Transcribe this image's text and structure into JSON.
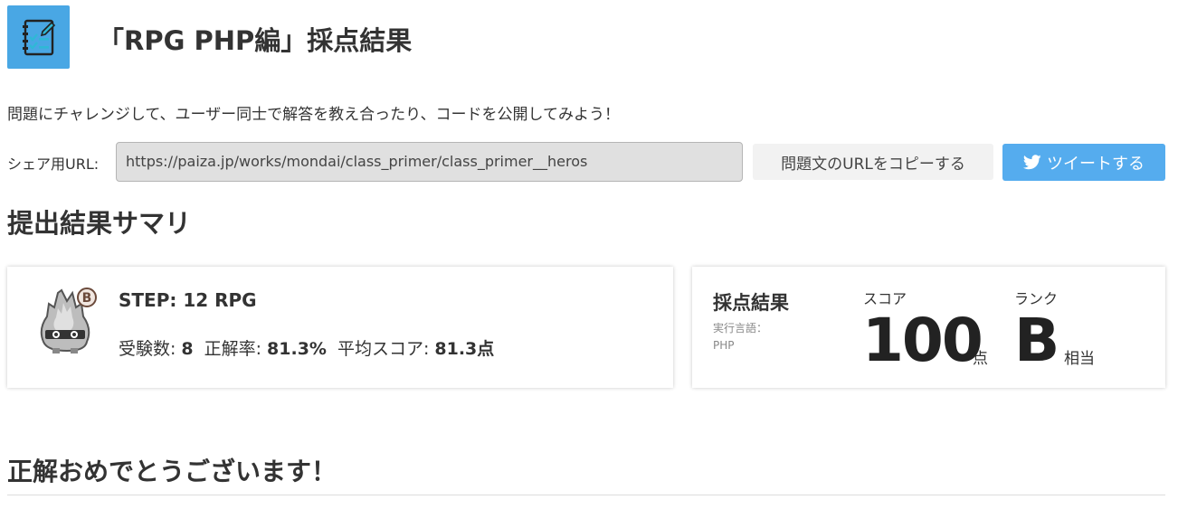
{
  "header": {
    "title": "「RPG PHP編」採点結果",
    "icon": "checklist-icon"
  },
  "lead_text": "問題にチャレンジして、ユーザー同士で解答を教え合ったり、コードを公開してみよう！",
  "share": {
    "label": "シェア用URL:",
    "url": "https://paiza.jp/works/mondai/class_primer/class_primer__heros",
    "copy_label": "問題文のURLをコピーする",
    "tweet_label": "ツイートする",
    "tweet_icon": "twitter-bird-icon",
    "tweet_color": "#55acee"
  },
  "summary": {
    "title": "提出結果サマリ",
    "step_title": "STEP: 12 RPG",
    "mascot_icon": "flame-mascot-icon",
    "rank_badge": "B",
    "examinees_label": "受験数:",
    "examinees_value": "8",
    "accuracy_label": "正解率:",
    "accuracy_value": "81.3%",
    "average_label": "平均スコア:",
    "average_value": "81.3点"
  },
  "result": {
    "heading": "採点結果",
    "language_label": "実行言語：",
    "language_value": "PHP",
    "score_label": "スコア",
    "score_value": "100",
    "score_unit": "点",
    "rank_label": "ランク",
    "rank_value": "B",
    "rank_unit": "相当"
  },
  "congrats": "正解おめでとうございます！",
  "colors": {
    "accent": "#49a7e4",
    "text": "#333333"
  }
}
